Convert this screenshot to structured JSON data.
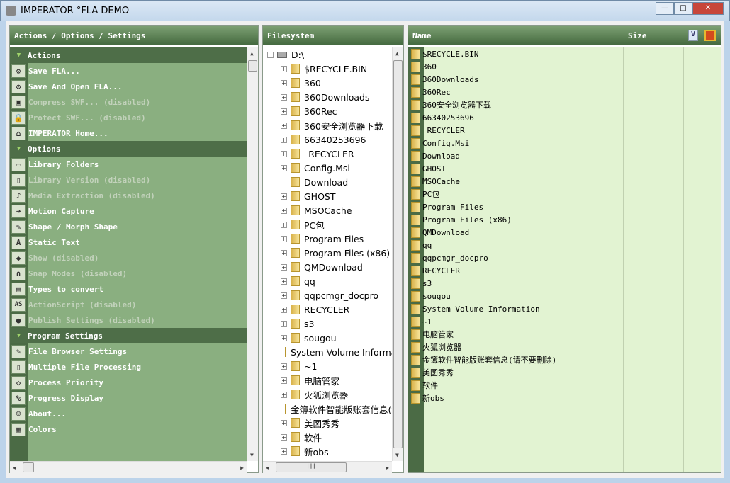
{
  "window": {
    "title": "IMPERATOR °FLA DEMO",
    "min": "—",
    "max": "□",
    "close": "✕"
  },
  "left": {
    "header": "Actions / Options / Settings",
    "rows": [
      {
        "type": "sec",
        "label": "Actions"
      },
      {
        "label": "Save FLA...",
        "icon": "gear-icon",
        "g": "⚙"
      },
      {
        "label": "Save And Open FLA...",
        "icon": "gear-arrow-icon",
        "g": "⚙"
      },
      {
        "label": "Compress SWF... (disabled)",
        "icon": "compress-icon",
        "g": "▣",
        "dis": true
      },
      {
        "label": "Protect SWF... (disabled)",
        "icon": "lock-icon",
        "g": "🔒",
        "dis": true
      },
      {
        "label": "IMPERATOR Home...",
        "icon": "home-icon",
        "g": "⌂"
      },
      {
        "type": "sec",
        "label": "Options"
      },
      {
        "label": "Library Folders",
        "icon": "folder-icon",
        "g": "▭"
      },
      {
        "label": "Library Version (disabled)",
        "icon": "document-icon",
        "g": "▯",
        "dis": true
      },
      {
        "label": "Media Extraction (disabled)",
        "icon": "media-icon",
        "g": "♪",
        "dis": true
      },
      {
        "label": "Motion Capture",
        "icon": "arrow-icon",
        "g": "➜"
      },
      {
        "label": "Shape / Morph Shape",
        "icon": "brush-icon",
        "g": "✎"
      },
      {
        "label": "Static Text",
        "icon": "text-icon",
        "g": "A"
      },
      {
        "label": "Show (disabled)",
        "icon": "show-icon",
        "g": "◆",
        "dis": true
      },
      {
        "label": "Snap Modes (disabled)",
        "icon": "magnet-icon",
        "g": "∩",
        "dis": true
      },
      {
        "label": "Types to convert",
        "icon": "types-icon",
        "g": "▤"
      },
      {
        "label": "ActionScript (disabled)",
        "icon": "actionscript-icon",
        "g": "AS",
        "dis": true
      },
      {
        "label": "Publish Settings (disabled)",
        "icon": "globe-icon",
        "g": "●",
        "dis": true
      },
      {
        "type": "sec",
        "label": "Program Settings"
      },
      {
        "label": "File Browser Settings",
        "icon": "browser-icon",
        "g": "✎"
      },
      {
        "label": "Multiple File Processing",
        "icon": "files-icon",
        "g": "▯"
      },
      {
        "label": "Process Priority",
        "icon": "eraser-icon",
        "g": "◇"
      },
      {
        "label": "Progress Display",
        "icon": "percent-icon",
        "g": "%"
      },
      {
        "label": "About...",
        "icon": "info-icon",
        "g": "☺"
      },
      {
        "label": "Colors",
        "icon": "palette-icon",
        "g": "▦"
      }
    ]
  },
  "filesystem": {
    "header": "Filesystem",
    "root": "D:\\",
    "items": [
      {
        "name": "$RECYCLE.BIN",
        "exp": true
      },
      {
        "name": "360",
        "exp": true
      },
      {
        "name": "360Downloads",
        "exp": true
      },
      {
        "name": "360Rec",
        "exp": true
      },
      {
        "name": "360安全浏览器下载",
        "exp": true
      },
      {
        "name": "66340253696",
        "exp": true
      },
      {
        "name": "_RECYCLER",
        "exp": true
      },
      {
        "name": "Config.Msi",
        "exp": true
      },
      {
        "name": "Download",
        "exp": false
      },
      {
        "name": "GHOST",
        "exp": true
      },
      {
        "name": "MSOCache",
        "exp": true
      },
      {
        "name": "PC包",
        "exp": true
      },
      {
        "name": "Program Files",
        "exp": true
      },
      {
        "name": "Program Files (x86)",
        "exp": true
      },
      {
        "name": "QMDownload",
        "exp": true
      },
      {
        "name": "qq",
        "exp": true
      },
      {
        "name": "qqpcmgr_docpro",
        "exp": true
      },
      {
        "name": "RECYCLER",
        "exp": true
      },
      {
        "name": "s3",
        "exp": true
      },
      {
        "name": "sougou",
        "exp": true
      },
      {
        "name": "System Volume Information",
        "exp": false
      },
      {
        "name": "~1",
        "exp": true
      },
      {
        "name": "电脑管家",
        "exp": true
      },
      {
        "name": "火狐浏览器",
        "exp": true
      },
      {
        "name": "金簿软件智能版账套信息(请不要删除)",
        "exp": false
      },
      {
        "name": "美图秀秀",
        "exp": true
      },
      {
        "name": "软件",
        "exp": true
      },
      {
        "name": "新obs",
        "exp": true
      }
    ]
  },
  "files": {
    "col_name": "Name",
    "col_size": "Size",
    "v_button": "V",
    "items": [
      "$RECYCLE.BIN",
      "360",
      "360Downloads",
      "360Rec",
      "360安全浏览器下载",
      "66340253696",
      "_RECYCLER",
      "Config.Msi",
      "Download",
      "GHOST",
      "MSOCache",
      "PC包",
      "Program Files",
      "Program Files (x86)",
      "QMDownload",
      "qq",
      "qqpcmgr_docpro",
      "RECYCLER",
      "s3",
      "sougou",
      "System Volume Information",
      "~1",
      "电脑管家",
      "火狐浏览器",
      "金簿软件智能版账套信息(请不要删除)",
      "美图秀秀",
      "软件",
      "新obs"
    ]
  },
  "scroll": {
    "up": "▲",
    "down": "▼",
    "left": "◀",
    "right": "▶",
    "grip": "|||"
  }
}
